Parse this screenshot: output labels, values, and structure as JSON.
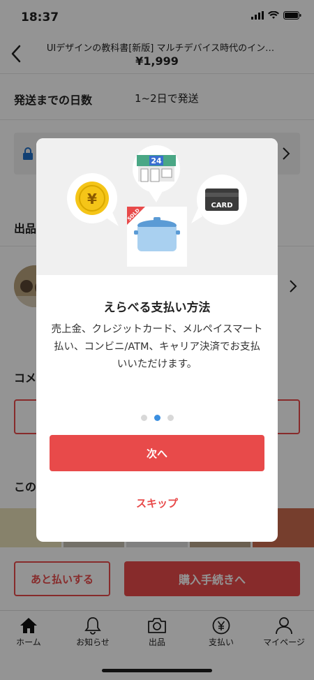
{
  "status": {
    "time": "18:37"
  },
  "header": {
    "title": "UIデザインの教科書[新版] マルチデバイス時代のイン…",
    "price": "¥1,999"
  },
  "shipping": {
    "label": "発送までの日数",
    "value": "1~2日で発送"
  },
  "background": {
    "seller_label": "出品",
    "comment_label": "コメ",
    "related_label": "この"
  },
  "actions": {
    "pay_later": "あと払いする",
    "checkout": "購入手続きへ"
  },
  "tabs": [
    {
      "label": "ホーム",
      "icon": "home-icon"
    },
    {
      "label": "お知らせ",
      "icon": "bell-icon"
    },
    {
      "label": "出品",
      "icon": "camera-icon"
    },
    {
      "label": "支払い",
      "icon": "yen-icon"
    },
    {
      "label": "マイページ",
      "icon": "person-icon"
    }
  ],
  "modal": {
    "illustration": {
      "store_number": "24",
      "card_text": "CARD",
      "sold_text": "SOLD",
      "coin_symbol": "¥"
    },
    "title": "えらべる支払い方法",
    "body": "売上金、クレジットカード、メルペイスマート払い、コンビニ/ATM、キャリア決済でお支払いいただけます。",
    "pager": {
      "count": 3,
      "active": 1
    },
    "next_label": "次へ",
    "skip_label": "スキップ"
  },
  "colors": {
    "accent": "#e84a4a",
    "pager_active": "#3b8fe0",
    "coin": "#f5c518"
  }
}
